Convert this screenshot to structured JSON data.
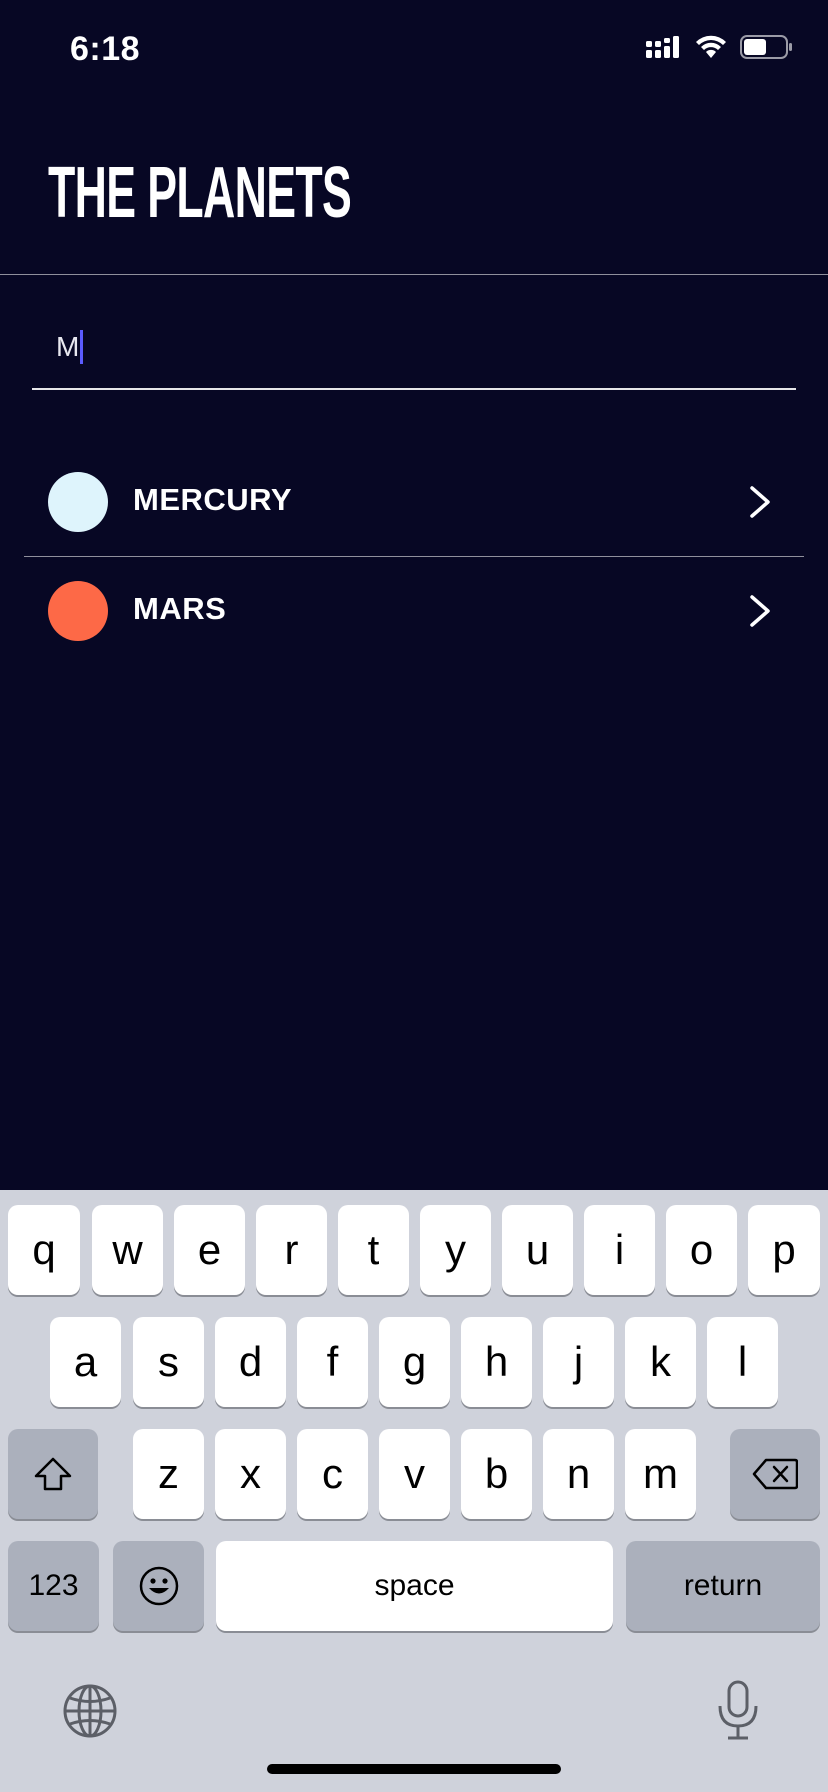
{
  "status_bar": {
    "time": "6:18",
    "icons": [
      "signal-icon",
      "wifi-icon",
      "battery-icon"
    ]
  },
  "app": {
    "title": "THE PLANETS"
  },
  "search": {
    "value": "M"
  },
  "planets": [
    {
      "name": "MERCURY",
      "color": "#DEF4FC"
    },
    {
      "name": "MARS",
      "color": "#FD6947"
    }
  ],
  "keyboard": {
    "row1": [
      "q",
      "w",
      "e",
      "r",
      "t",
      "y",
      "u",
      "i",
      "o",
      "p"
    ],
    "row2": [
      "a",
      "s",
      "d",
      "f",
      "g",
      "h",
      "j",
      "k",
      "l"
    ],
    "row3": [
      "z",
      "x",
      "c",
      "v",
      "b",
      "n",
      "m"
    ],
    "numbers_label": "123",
    "space_label": "space",
    "return_label": "return",
    "icons": [
      "shift-icon",
      "backspace-icon",
      "emoji-icon",
      "globe-icon",
      "microphone-icon"
    ]
  }
}
